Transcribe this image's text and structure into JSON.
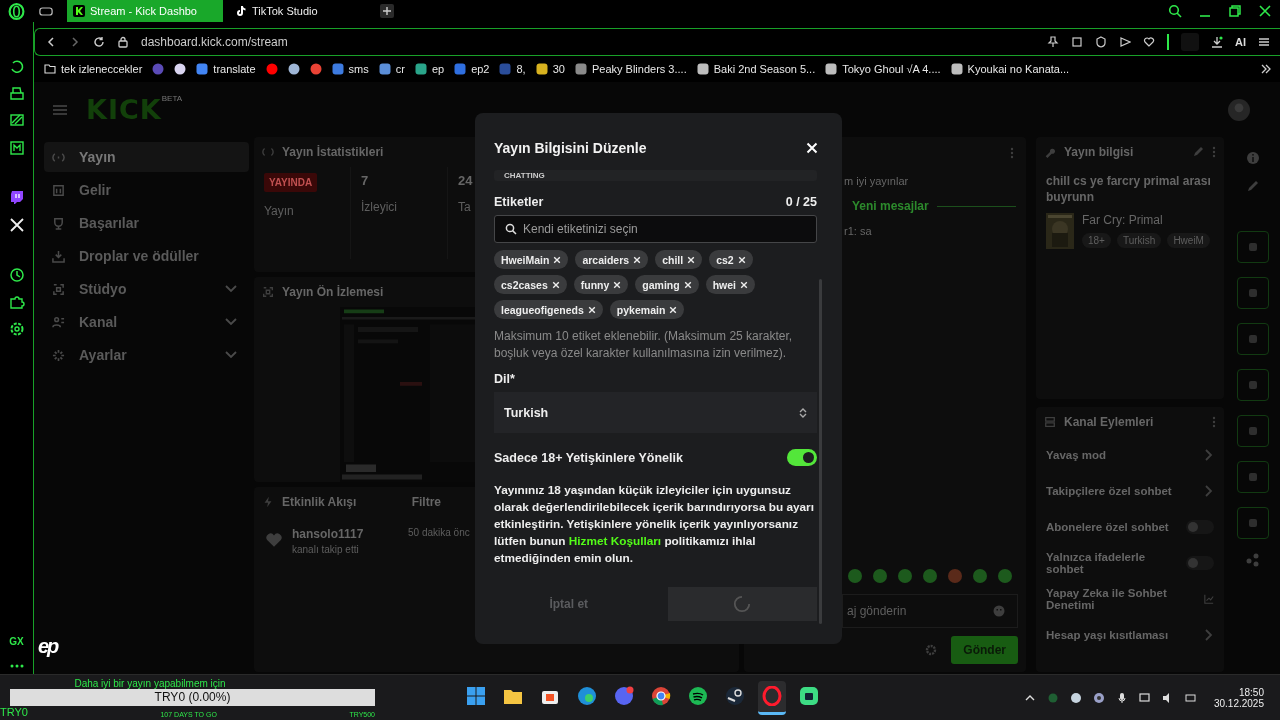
{
  "browser": {
    "tabs": [
      {
        "label": "Stream - Kick Dashbo",
        "selected": true
      },
      {
        "label": "TikTok Studio",
        "selected": false
      }
    ],
    "address": "dashboard.kick.com/stream",
    "ai_label": "AI",
    "bookmarks": [
      {
        "kind": "folder",
        "label": "tek izleneccekler"
      },
      {
        "kind": "icon",
        "color": "#5b4bb7"
      },
      {
        "kind": "icon",
        "color": "#d9d4f0"
      },
      {
        "kind": "site",
        "label": "translate",
        "color": "#4285f4"
      },
      {
        "kind": "icon",
        "color": "#ff0000"
      },
      {
        "kind": "icon",
        "color": "#9fb6d6"
      },
      {
        "kind": "icon",
        "color": "#ea4335"
      },
      {
        "kind": "site",
        "label": "sms",
        "color": "#3d7be0"
      },
      {
        "kind": "site",
        "label": "cr",
        "color": "#5b8ed8"
      },
      {
        "kind": "site",
        "label": "ep",
        "color": "#2aa58a"
      },
      {
        "kind": "site",
        "label": "ep2",
        "color": "#2f6fe0"
      },
      {
        "kind": "site",
        "label": "8,",
        "color": "#2a4d9a"
      },
      {
        "kind": "site",
        "label": "30",
        "color": "#d8b21f"
      },
      {
        "kind": "site",
        "label": "Peaky Blinders 3....",
        "color": "#8a8a8a"
      },
      {
        "kind": "site",
        "label": "Baki 2nd Season 5...",
        "color": "#bdbdbd"
      },
      {
        "kind": "site",
        "label": "Tokyo Ghoul √A 4....",
        "color": "#bdbdbd"
      },
      {
        "kind": "site",
        "label": "Kyoukai no Kanata...",
        "color": "#bdbdbd"
      }
    ]
  },
  "opera_sidebar": {
    "gx_label": "GX"
  },
  "kick": {
    "logo": "KICK",
    "logo_badge": "BETA",
    "ep_logo": "ep",
    "nav": [
      {
        "label": "Yayın",
        "kind": "broadcast",
        "selected": true,
        "expandable": false
      },
      {
        "label": "Gelir",
        "kind": "revenue",
        "selected": false,
        "expandable": false
      },
      {
        "label": "Başarılar",
        "kind": "trophy",
        "selected": false,
        "expandable": false
      },
      {
        "label": "Droplar ve ödüller",
        "kind": "drops",
        "selected": false,
        "expandable": false
      },
      {
        "label": "Stüdyo",
        "kind": "studio",
        "selected": false,
        "expandable": true
      },
      {
        "label": "Kanal",
        "kind": "channel",
        "selected": false,
        "expandable": true
      },
      {
        "label": "Ayarlar",
        "kind": "settings",
        "selected": false,
        "expandable": true
      }
    ],
    "stats": {
      "title": "Yayın İstatistikleri",
      "items": [
        {
          "kind": "badge",
          "value": "YAYINDA",
          "label": "Yayın"
        },
        {
          "kind": "number",
          "value": "7",
          "label": "İzleyici"
        },
        {
          "kind": "number",
          "value": "24",
          "label": "Ta"
        }
      ]
    },
    "preview": {
      "title": "Yayın Ön İzlemesi"
    },
    "events": {
      "title": "Etkinlik Akışı",
      "filter": "Filtre",
      "items": [
        {
          "user": "hansolo1117",
          "action": "kanalı takip etti",
          "time": "50 dakika önc"
        }
      ]
    },
    "chat": {
      "messages": [
        {
          "kind": "text",
          "text": "m iyi yayınlar"
        },
        {
          "kind": "divider",
          "text": "Yeni mesajlar"
        },
        {
          "kind": "text",
          "text": "r1: sa"
        }
      ],
      "placeholder": "aj gönderin",
      "send": "Gönder"
    },
    "stream_info": {
      "title": "Yayın bilgisi",
      "stream_title": "chill cs ye farcry primal arası buyrunn",
      "game": "Far Cry: Primal",
      "tags": [
        "18+",
        "Turkish",
        "HweiM"
      ]
    },
    "channel_actions": {
      "title": "Kanal Eylemleri",
      "items": [
        {
          "kind": "link",
          "label": "Yavaş mod"
        },
        {
          "kind": "link",
          "label": "Takipçilere özel sohbet"
        },
        {
          "kind": "toggle",
          "label": "Abonelere özel sohbet",
          "on": false
        },
        {
          "kind": "toggle",
          "label": "Yalnızca ifadelerle sohbet",
          "on": false
        },
        {
          "kind": "external",
          "label": "Yapay Zeka ile Sohbet Denetimi"
        },
        {
          "kind": "link",
          "label": "Hesap yaşı kısıtlaması"
        }
      ]
    }
  },
  "modal": {
    "title": "Yayın Bilgisini Düzenle",
    "category_caption": "CHATTING",
    "tags_label": "Etiketler",
    "tags_count": "0 / 25",
    "search_placeholder": "Kendi etiketinizi seçin",
    "tags": [
      "HweiMain",
      "arcaiders",
      "chill",
      "cs2",
      "cs2cases",
      "funny",
      "gaming",
      "hwei",
      "leagueofigeneds",
      "pykemain"
    ],
    "hint": "Maksimum 10 etiket eklenebilir. (Maksimum 25 karakter, boşluk veya özel karakter kullanılmasına izin verilmez).",
    "language_label": "Dil*",
    "language": "Turkish",
    "adult_label": "Sadece 18+ Yetişkinlere Yönelik",
    "adult_on": true,
    "adult_text_before": "Yayınınız 18 yaşından küçük izleyiciler için uygunsuz olarak değerlendirilebilecek içerik barındırıyorsa bu ayarı etkinleştirin. Yetişkinlere yönelik içerik yayınlıyorsanız lütfen bunun",
    "adult_link": "Hizmet Koşulları",
    "adult_text_after": "politikamızı ihlal etmediğinden emin olun.",
    "cancel": "İptal et",
    "saving": true
  },
  "taskbar": {
    "widget": {
      "caption": "Daha iyi bir yayın yapabilmem için",
      "bar_text": "TRY0 (0.00%)",
      "level": 0,
      "left": "TRY0",
      "middle": "107 DAYS TO GO",
      "right": "TRY500"
    },
    "apps": [
      {
        "kind": "windows",
        "selected": false
      },
      {
        "kind": "explorer",
        "selected": false
      },
      {
        "kind": "store",
        "selected": false
      },
      {
        "kind": "edge",
        "selected": false
      },
      {
        "kind": "discord",
        "selected": false
      },
      {
        "kind": "chrome",
        "selected": false
      },
      {
        "kind": "spotify",
        "selected": false
      },
      {
        "kind": "steam",
        "selected": false
      },
      {
        "kind": "opera",
        "selected": true
      },
      {
        "kind": "app",
        "selected": false
      }
    ],
    "time": "18:50",
    "date": "30.12.2025"
  }
}
